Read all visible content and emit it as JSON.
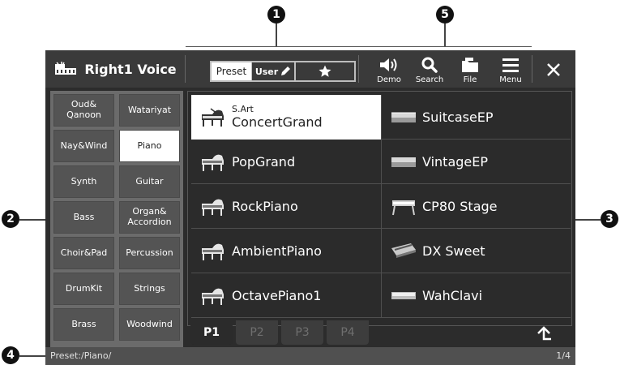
{
  "callouts": {
    "c1": "1",
    "c2": "2",
    "c3": "3",
    "c4": "4",
    "c5": "5"
  },
  "header": {
    "title": "Right1 Voice",
    "preset_label": "Preset",
    "user_label": "User",
    "buttons": {
      "demo": "Demo",
      "search": "Search",
      "file": "File",
      "menu": "Menu"
    }
  },
  "categories": [
    {
      "label": "Oud&\nQanoon",
      "active": false
    },
    {
      "label": "Watariyat",
      "active": false
    },
    {
      "label": "Nay&Wind",
      "active": false
    },
    {
      "label": "Piano",
      "active": true
    },
    {
      "label": "Synth",
      "active": false
    },
    {
      "label": "Guitar",
      "active": false
    },
    {
      "label": "Bass",
      "active": false
    },
    {
      "label": "Organ&\nAccordion",
      "active": false
    },
    {
      "label": "Choir&Pad",
      "active": false
    },
    {
      "label": "Percussion",
      "active": false
    },
    {
      "label": "DrumKit",
      "active": false
    },
    {
      "label": "Strings",
      "active": false
    },
    {
      "label": "Brass",
      "active": false
    },
    {
      "label": "Woodwind",
      "active": false
    }
  ],
  "voices": [
    {
      "prefix": "S.Art",
      "name": "ConcertGrand",
      "icon": "grand-piano-icon",
      "selected": true
    },
    {
      "prefix": "",
      "name": "SuitcaseEP",
      "icon": "electric-piano-icon",
      "selected": false
    },
    {
      "prefix": "",
      "name": "PopGrand",
      "icon": "grand-piano-icon",
      "selected": false
    },
    {
      "prefix": "",
      "name": "VintageEP",
      "icon": "electric-piano-icon",
      "selected": false
    },
    {
      "prefix": "",
      "name": "RockPiano",
      "icon": "grand-piano-icon",
      "selected": false
    },
    {
      "prefix": "",
      "name": "CP80 Stage",
      "icon": "stage-piano-icon",
      "selected": false
    },
    {
      "prefix": "",
      "name": "AmbientPiano",
      "icon": "grand-piano-icon",
      "selected": false
    },
    {
      "prefix": "",
      "name": "DX Sweet",
      "icon": "synth-keyboard-icon",
      "selected": false
    },
    {
      "prefix": "",
      "name": "OctavePiano1",
      "icon": "grand-piano-icon",
      "selected": false
    },
    {
      "prefix": "",
      "name": "WahClavi",
      "icon": "clavi-icon",
      "selected": false
    }
  ],
  "pages": [
    {
      "label": "P1",
      "active": true
    },
    {
      "label": "P2",
      "active": false
    },
    {
      "label": "P3",
      "active": false
    },
    {
      "label": "P4",
      "active": false
    }
  ],
  "status": {
    "path": "Preset:/Piano/",
    "page": "1/4"
  }
}
